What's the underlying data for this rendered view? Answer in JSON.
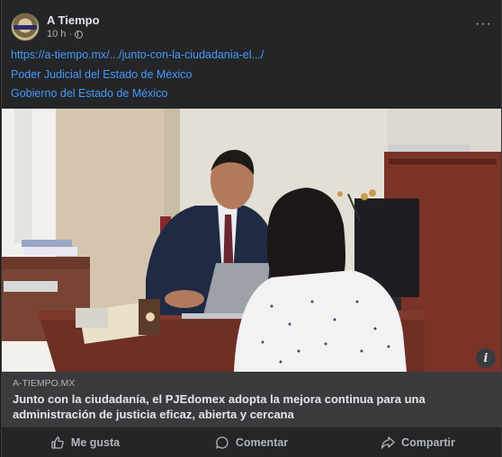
{
  "post": {
    "author": "A Tiempo",
    "time": "10 h ·",
    "more_label": "···",
    "links": [
      "https://a-tiempo.mx/.../junto-con-la-ciudadania-el.../",
      "Poder Judicial del Estado de México",
      "Gobierno del Estado de México"
    ],
    "info_label": "i"
  },
  "preview": {
    "domain": "A-TIEMPO.MX",
    "title": "Junto con la ciudadanía, el PJEdomex adopta la mejora continua para una administración de justicia eficaz, abierta y cercana"
  },
  "actions": {
    "like": "Me gusta",
    "comment": "Comentar",
    "share": "Compartir"
  },
  "icons": [
    "globe-icon",
    "more-icon",
    "info-icon",
    "like-icon",
    "comment-icon",
    "share-icon"
  ]
}
